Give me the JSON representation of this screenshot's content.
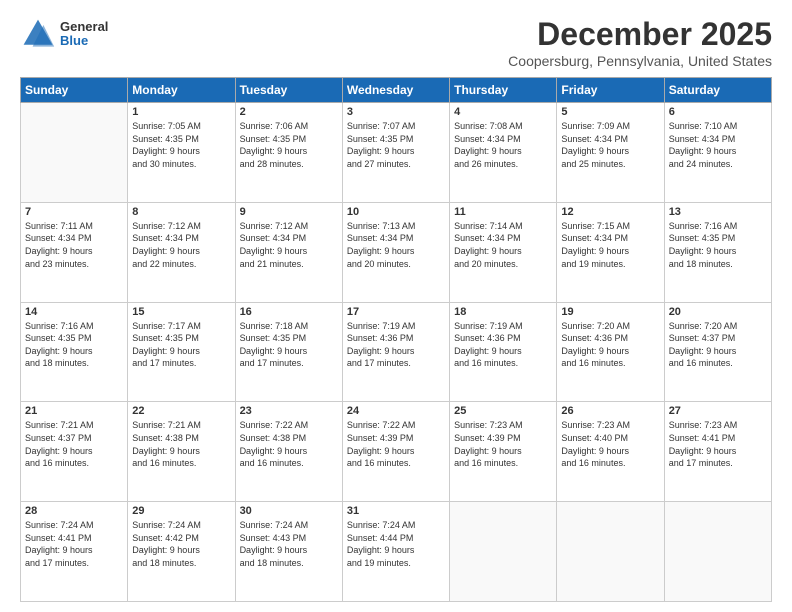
{
  "header": {
    "logo_general": "General",
    "logo_blue": "Blue",
    "month_title": "December 2025",
    "location": "Coopersburg, Pennsylvania, United States"
  },
  "days_of_week": [
    "Sunday",
    "Monday",
    "Tuesday",
    "Wednesday",
    "Thursday",
    "Friday",
    "Saturday"
  ],
  "weeks": [
    [
      {
        "num": "",
        "info": ""
      },
      {
        "num": "1",
        "info": "Sunrise: 7:05 AM\nSunset: 4:35 PM\nDaylight: 9 hours\nand 30 minutes."
      },
      {
        "num": "2",
        "info": "Sunrise: 7:06 AM\nSunset: 4:35 PM\nDaylight: 9 hours\nand 28 minutes."
      },
      {
        "num": "3",
        "info": "Sunrise: 7:07 AM\nSunset: 4:35 PM\nDaylight: 9 hours\nand 27 minutes."
      },
      {
        "num": "4",
        "info": "Sunrise: 7:08 AM\nSunset: 4:34 PM\nDaylight: 9 hours\nand 26 minutes."
      },
      {
        "num": "5",
        "info": "Sunrise: 7:09 AM\nSunset: 4:34 PM\nDaylight: 9 hours\nand 25 minutes."
      },
      {
        "num": "6",
        "info": "Sunrise: 7:10 AM\nSunset: 4:34 PM\nDaylight: 9 hours\nand 24 minutes."
      }
    ],
    [
      {
        "num": "7",
        "info": "Sunrise: 7:11 AM\nSunset: 4:34 PM\nDaylight: 9 hours\nand 23 minutes."
      },
      {
        "num": "8",
        "info": "Sunrise: 7:12 AM\nSunset: 4:34 PM\nDaylight: 9 hours\nand 22 minutes."
      },
      {
        "num": "9",
        "info": "Sunrise: 7:12 AM\nSunset: 4:34 PM\nDaylight: 9 hours\nand 21 minutes."
      },
      {
        "num": "10",
        "info": "Sunrise: 7:13 AM\nSunset: 4:34 PM\nDaylight: 9 hours\nand 20 minutes."
      },
      {
        "num": "11",
        "info": "Sunrise: 7:14 AM\nSunset: 4:34 PM\nDaylight: 9 hours\nand 20 minutes."
      },
      {
        "num": "12",
        "info": "Sunrise: 7:15 AM\nSunset: 4:34 PM\nDaylight: 9 hours\nand 19 minutes."
      },
      {
        "num": "13",
        "info": "Sunrise: 7:16 AM\nSunset: 4:35 PM\nDaylight: 9 hours\nand 18 minutes."
      }
    ],
    [
      {
        "num": "14",
        "info": "Sunrise: 7:16 AM\nSunset: 4:35 PM\nDaylight: 9 hours\nand 18 minutes."
      },
      {
        "num": "15",
        "info": "Sunrise: 7:17 AM\nSunset: 4:35 PM\nDaylight: 9 hours\nand 17 minutes."
      },
      {
        "num": "16",
        "info": "Sunrise: 7:18 AM\nSunset: 4:35 PM\nDaylight: 9 hours\nand 17 minutes."
      },
      {
        "num": "17",
        "info": "Sunrise: 7:19 AM\nSunset: 4:36 PM\nDaylight: 9 hours\nand 17 minutes."
      },
      {
        "num": "18",
        "info": "Sunrise: 7:19 AM\nSunset: 4:36 PM\nDaylight: 9 hours\nand 16 minutes."
      },
      {
        "num": "19",
        "info": "Sunrise: 7:20 AM\nSunset: 4:36 PM\nDaylight: 9 hours\nand 16 minutes."
      },
      {
        "num": "20",
        "info": "Sunrise: 7:20 AM\nSunset: 4:37 PM\nDaylight: 9 hours\nand 16 minutes."
      }
    ],
    [
      {
        "num": "21",
        "info": "Sunrise: 7:21 AM\nSunset: 4:37 PM\nDaylight: 9 hours\nand 16 minutes."
      },
      {
        "num": "22",
        "info": "Sunrise: 7:21 AM\nSunset: 4:38 PM\nDaylight: 9 hours\nand 16 minutes."
      },
      {
        "num": "23",
        "info": "Sunrise: 7:22 AM\nSunset: 4:38 PM\nDaylight: 9 hours\nand 16 minutes."
      },
      {
        "num": "24",
        "info": "Sunrise: 7:22 AM\nSunset: 4:39 PM\nDaylight: 9 hours\nand 16 minutes."
      },
      {
        "num": "25",
        "info": "Sunrise: 7:23 AM\nSunset: 4:39 PM\nDaylight: 9 hours\nand 16 minutes."
      },
      {
        "num": "26",
        "info": "Sunrise: 7:23 AM\nSunset: 4:40 PM\nDaylight: 9 hours\nand 16 minutes."
      },
      {
        "num": "27",
        "info": "Sunrise: 7:23 AM\nSunset: 4:41 PM\nDaylight: 9 hours\nand 17 minutes."
      }
    ],
    [
      {
        "num": "28",
        "info": "Sunrise: 7:24 AM\nSunset: 4:41 PM\nDaylight: 9 hours\nand 17 minutes."
      },
      {
        "num": "29",
        "info": "Sunrise: 7:24 AM\nSunset: 4:42 PM\nDaylight: 9 hours\nand 18 minutes."
      },
      {
        "num": "30",
        "info": "Sunrise: 7:24 AM\nSunset: 4:43 PM\nDaylight: 9 hours\nand 18 minutes."
      },
      {
        "num": "31",
        "info": "Sunrise: 7:24 AM\nSunset: 4:44 PM\nDaylight: 9 hours\nand 19 minutes."
      },
      {
        "num": "",
        "info": ""
      },
      {
        "num": "",
        "info": ""
      },
      {
        "num": "",
        "info": ""
      }
    ]
  ]
}
